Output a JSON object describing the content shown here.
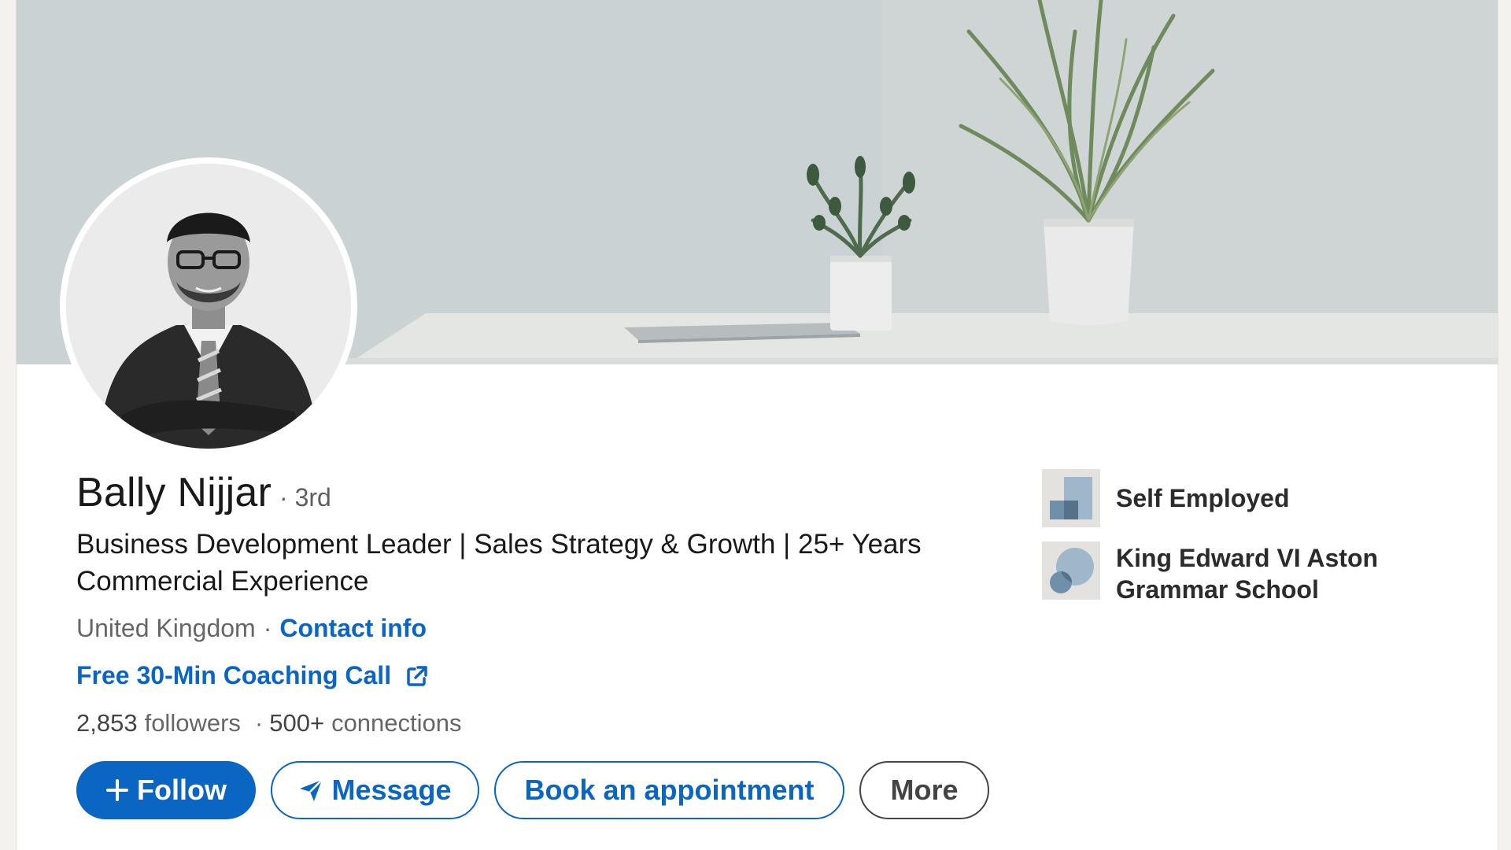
{
  "profile": {
    "name": "Bally Nijjar",
    "degree": "· 3rd",
    "headline": "Business Development Leader | Sales Strategy & Growth | 25+ Years Commercial Experience",
    "location": "United Kingdom",
    "separator": "·",
    "contact_label": "Contact info",
    "coaching_link": "Free 30-Min Coaching Call",
    "followers_count": "2,853",
    "followers_label": "followers",
    "stats_separator": "·",
    "connections_count": "500+",
    "connections_label": "connections"
  },
  "actions": {
    "follow": "Follow",
    "message": "Message",
    "book": "Book an appointment",
    "more": "More"
  },
  "sidebar": {
    "items": [
      {
        "label": "Self Employed",
        "icon": "company-logo-icon"
      },
      {
        "label": "King Edward VI Aston Grammar School",
        "icon": "school-logo-icon"
      }
    ]
  },
  "colors": {
    "accent": "#0a66c2",
    "text": "#191919",
    "muted": "#666666"
  }
}
